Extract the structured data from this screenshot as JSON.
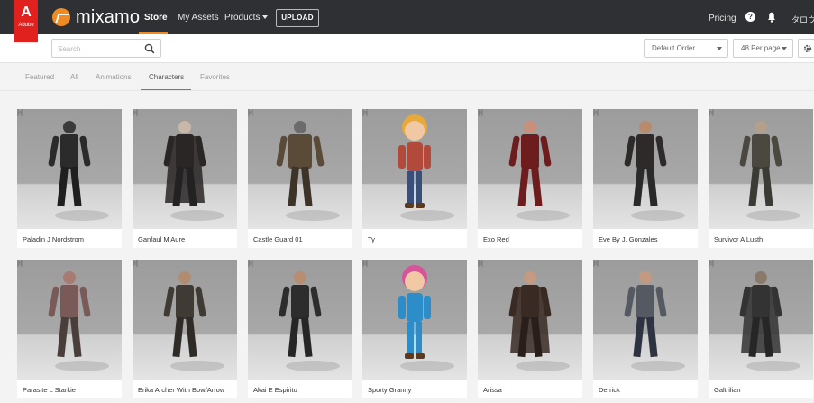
{
  "adobe": {
    "mark": "A",
    "word": "Adobe"
  },
  "brand": {
    "name": "mixamo",
    "accent": "#f08a24"
  },
  "nav": {
    "store": "Store",
    "my_assets": "My Assets",
    "products": "Products",
    "upload": "UPLOAD",
    "pricing": "Pricing",
    "help": "?",
    "user": "タロウ"
  },
  "search": {
    "placeholder": "Search",
    "value": ""
  },
  "sort": {
    "selected": "Default Order"
  },
  "per_page": {
    "selected": "48 Per page"
  },
  "tabs": [
    {
      "label": "Featured",
      "active": false
    },
    {
      "label": "All",
      "active": false
    },
    {
      "label": "Animations",
      "active": false
    },
    {
      "label": "Characters",
      "active": true
    },
    {
      "label": "Favorites",
      "active": false
    }
  ],
  "characters": [
    {
      "name": "Paladin J Nordstrom",
      "icon": "armored-knight-icon"
    },
    {
      "name": "Ganfaul M Aure",
      "icon": "dark-warrior-icon"
    },
    {
      "name": "Castle Guard 01",
      "icon": "helmet-knight-icon"
    },
    {
      "name": "Ty",
      "icon": "cartoon-boy-icon"
    },
    {
      "name": "Exo Red",
      "icon": "exo-suit-icon"
    },
    {
      "name": "Eve By J. Gonzales",
      "icon": "female-warrior-icon"
    },
    {
      "name": "Survivor A Lusth",
      "icon": "survivor-icon"
    },
    {
      "name": "Parasite L Starkie",
      "icon": "zombie-icon"
    },
    {
      "name": "Erika Archer With Bow/Arrow",
      "icon": "archer-icon"
    },
    {
      "name": "Akai E Espiritu",
      "icon": "hooded-fighter-icon"
    },
    {
      "name": "Sporty Granny",
      "icon": "cartoon-granny-icon"
    },
    {
      "name": "Arissa",
      "icon": "hooded-woman-icon"
    },
    {
      "name": "Derrick",
      "icon": "capped-man-icon"
    },
    {
      "name": "Galtrilian",
      "icon": "hooded-ranger-icon"
    }
  ]
}
